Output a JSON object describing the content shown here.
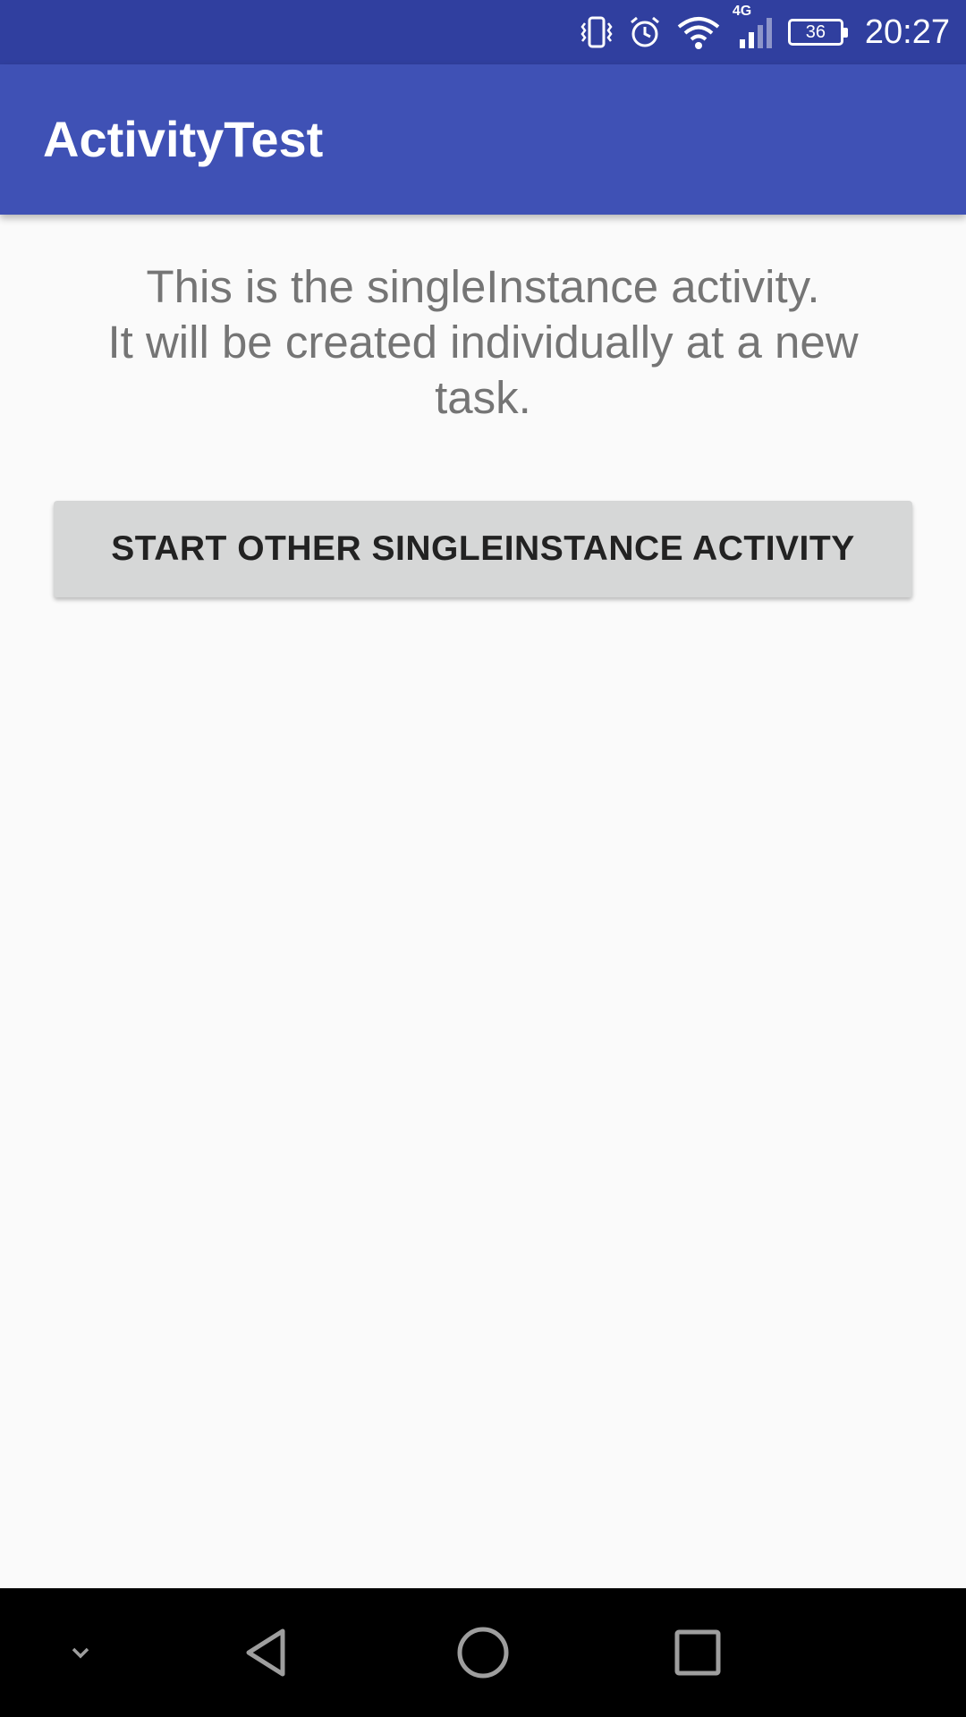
{
  "status_bar": {
    "network_label": "4G",
    "battery_level": "36",
    "time": "20:27",
    "icons": [
      "vibrate-icon",
      "alarm-icon",
      "wifi-icon",
      "cellular-signal-icon",
      "battery-icon"
    ],
    "background_color": "#303F9F"
  },
  "app_bar": {
    "title": "ActivityTest",
    "background_color": "#3F51B5"
  },
  "main": {
    "message": "This is the singleInstance activity.\nIt will be created individually at a new task.",
    "button_label": "START OTHER SINGLEINSTANCE ACTIVITY"
  },
  "nav_bar": {
    "buttons": [
      "hide-keyboard-icon",
      "back-icon",
      "home-icon",
      "recents-icon"
    ]
  }
}
